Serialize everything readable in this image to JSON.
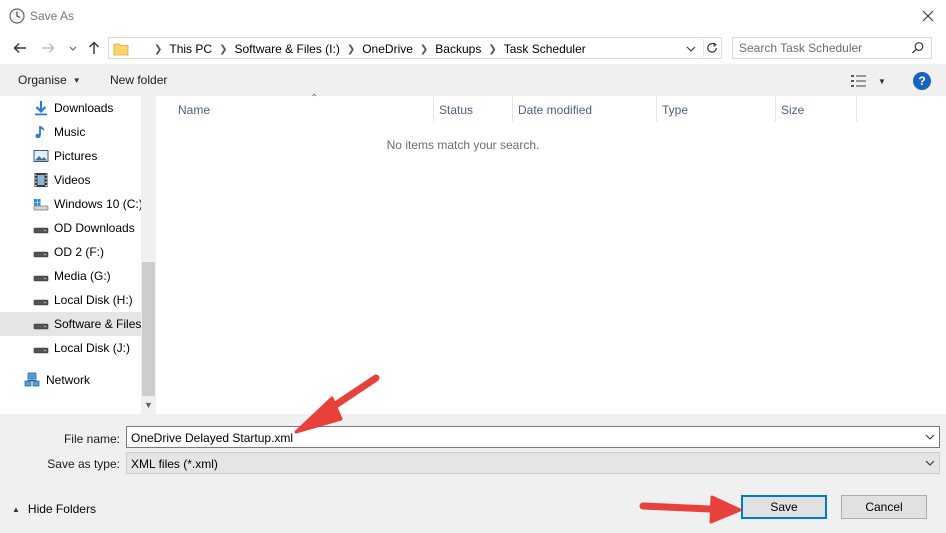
{
  "window": {
    "title": "Save As"
  },
  "address": {
    "breadcrumbs": [
      "This PC",
      "Software & Files (I:)",
      "OneDrive",
      "Backups",
      "Task Scheduler"
    ]
  },
  "search": {
    "placeholder": "Search Task Scheduler"
  },
  "toolbar": {
    "organise_label": "Organise",
    "new_folder_label": "New folder",
    "help_label": "?"
  },
  "navigation": {
    "items": [
      {
        "label": "Downloads",
        "icon": "downloads-icon"
      },
      {
        "label": "Music",
        "icon": "music-icon"
      },
      {
        "label": "Pictures",
        "icon": "pictures-icon"
      },
      {
        "label": "Videos",
        "icon": "videos-icon"
      },
      {
        "label": "Windows 10 (C:)",
        "icon": "windows-drive-icon"
      },
      {
        "label": "OD Downloads",
        "icon": "drive-icon"
      },
      {
        "label": "OD 2 (F:)",
        "icon": "drive-icon"
      },
      {
        "label": "Media (G:)",
        "icon": "drive-icon"
      },
      {
        "label": "Local Disk (H:)",
        "icon": "drive-icon"
      },
      {
        "label": "Software & Files",
        "icon": "drive-icon",
        "selected": true
      },
      {
        "label": "Local Disk (J:)",
        "icon": "drive-icon"
      },
      {
        "label": "Network",
        "icon": "network-icon"
      }
    ]
  },
  "file_list": {
    "columns": [
      "Name",
      "Status",
      "Date modified",
      "Type",
      "Size"
    ],
    "empty_message": "No items match your search."
  },
  "form": {
    "file_name_label": "File name:",
    "file_name_value": "OneDrive Delayed Startup.xml",
    "save_type_label": "Save as type:",
    "save_type_value": "XML files (*.xml)"
  },
  "footer": {
    "hide_folders_label": "Hide Folders",
    "save_label": "Save",
    "cancel_label": "Cancel"
  },
  "colors": {
    "accent": "#0078d7",
    "annotation_arrow": "#e8413c",
    "help": "#1565c0"
  }
}
